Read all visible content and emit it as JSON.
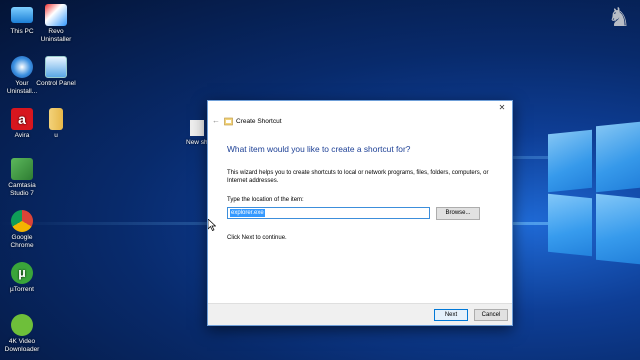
{
  "desktop": {
    "icons": [
      {
        "label": "This PC",
        "icon": "computer-icon"
      },
      {
        "label": "Revo Uninstaller",
        "icon": "revo-uninstaller-icon"
      },
      {
        "label": "Your Uninstall...",
        "icon": "your-uninstaller-icon"
      },
      {
        "label": "Control Panel",
        "icon": "control-panel-icon"
      },
      {
        "label": "Avira",
        "icon": "avira-icon"
      },
      {
        "label": "u",
        "icon": "folder-icon"
      },
      {
        "label": "Camtasia Studio 7",
        "icon": "camtasia-icon"
      },
      {
        "label": "Google Chrome",
        "icon": "chrome-icon"
      },
      {
        "label": "µTorrent",
        "icon": "utorrent-icon"
      },
      {
        "label": "4K Video Downloader",
        "icon": "4k-video-downloader-icon"
      }
    ],
    "behind_icon_label": "New sh"
  },
  "dialog": {
    "title": "Create Shortcut",
    "heading": "What item would you like to create a shortcut for?",
    "description": "This wizard helps you to create shortcuts to local or network programs, files, folders, computers, or Internet addresses.",
    "location_label": "Type the location of the item:",
    "location_value": "explorer.exe",
    "browse_label": "Browse...",
    "continue_hint": "Click Next to continue.",
    "next_label": "Next",
    "cancel_label": "Cancel",
    "close_glyph": "✕",
    "back_glyph": "←"
  },
  "colors": {
    "heading": "#1c3f95",
    "accent": "#0078d7"
  }
}
